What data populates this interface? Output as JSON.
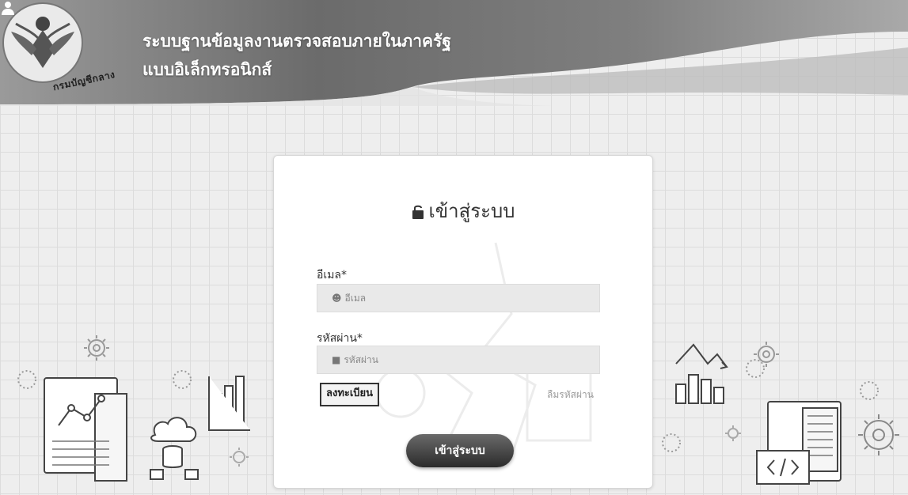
{
  "header": {
    "title_line_1": "ระบบฐานข้อมูลงานตรวจสอบภายในภาครัฐ",
    "title_line_2": "แบบอิเล็กทรอนิกส์",
    "emblem_text": "กรมบัญชีกลาง",
    "emblem_icon": "garuda-emblem-icon",
    "user_icon": "user-icon"
  },
  "login": {
    "heading": "เข้าสู่ระบบ",
    "heading_icon": "lock-icon",
    "email_label": "อีเมล*",
    "email_placeholder": "อีเมล",
    "password_label": "รหัสผ่าน*",
    "password_placeholder": "รหัสผ่าน",
    "register_label": "ลงทะเบียน",
    "forgot_label": "ลืมรหัสผ่าน",
    "submit_label": "เข้าสู่ระบบ"
  },
  "colors": {
    "header_dark": "#5c5c5c",
    "header_light": "#cfcfcf",
    "button_dark": "#2b2b2b",
    "field_bg": "#e9e9e9"
  }
}
